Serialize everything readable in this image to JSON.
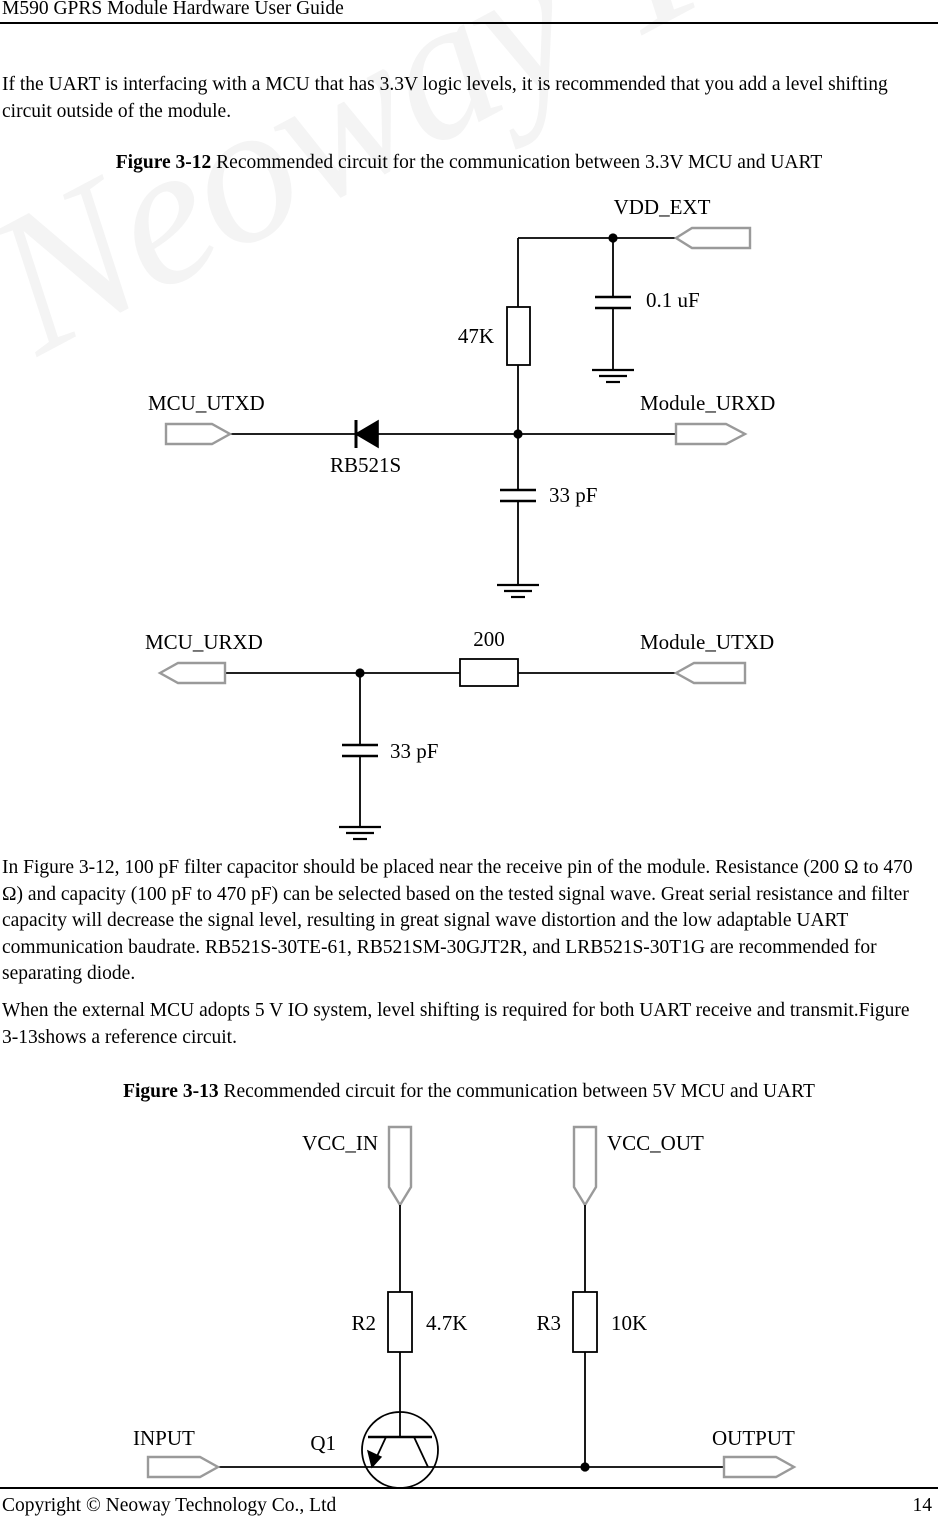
{
  "header": {
    "title": "M590 GPRS Module Hardware User Guide"
  },
  "watermark": {
    "text": "Neoway Technology"
  },
  "body": {
    "paragraph_1": "If the UART is interfacing with a MCU that has 3.3V logic levels, it is recommended that you add a level shifting circuit outside of the module.",
    "paragraph_2": "In Figure 3-12, 100 pF filter capacitor should be placed near the receive pin of the module. Resistance (200 Ω to 470 Ω) and capacity (100 pF to 470 pF) can be selected based on the tested signal wave. Great serial resistance and filter capacity will decrease the signal level, resulting in great signal wave distortion and the low adaptable UART communication baudrate. RB521S-30TE-61, RB521SM-30GJT2R, and LRB521S-30T1G are recommended for separating diode.",
    "paragraph_3": "When the external MCU adopts 5 V IO system, level shifting is required for both UART receive and transmit.Figure 3-13shows a reference circuit."
  },
  "figure_3_12": {
    "caption_label": "Figure 3-12",
    "caption_text": "Recommended circuit for the communication between 3.3V MCU and UART",
    "labels": {
      "vdd_ext": "VDD_EXT",
      "cap_01uf": "0.1 uF",
      "res_47k": "47K",
      "mcu_utxd": "MCU_UTXD",
      "module_urxd": "Module_URXD",
      "diode": "RB521S",
      "cap_33pf_top": "33 pF",
      "mcu_urxd": "MCU_URXD",
      "module_utxd": "Module_UTXD",
      "res_200": "200",
      "cap_33pf_bottom": "33 pF"
    }
  },
  "figure_3_13": {
    "caption_label": "Figure 3-13",
    "caption_text": "Recommended circuit for the communication between 5V MCU and UART",
    "labels": {
      "vcc_in": "VCC_IN",
      "vcc_out": "VCC_OUT",
      "r2_ref": "R2",
      "r2_value": "4.7K",
      "r3_ref": "R3",
      "r3_value": "10K",
      "q1_ref": "Q1",
      "input": "INPUT",
      "output": "OUTPUT"
    }
  },
  "footer": {
    "copyright": "Copyright © Neoway Technology Co., Ltd",
    "page_number": "14"
  },
  "colors": {
    "ink": "#000000",
    "port_outline": "#9a9a9a",
    "watermark": "#f4f4f4",
    "paper": "#ffffff"
  }
}
